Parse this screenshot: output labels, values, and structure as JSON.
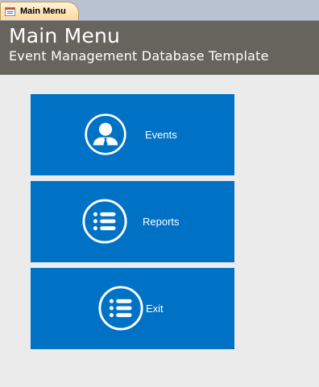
{
  "tab": {
    "label": "Main Menu"
  },
  "header": {
    "title": "Main Menu",
    "subtitle": "Event Management Database Template"
  },
  "buttons": [
    {
      "label": "Events",
      "icon": "person-icon"
    },
    {
      "label": "Reports",
      "icon": "list-icon"
    },
    {
      "label": "Exit",
      "icon": "list-icon"
    }
  ],
  "colors": {
    "header_bg": "#67645d",
    "button_bg": "#0072c6",
    "page_bg": "#ebebeb"
  }
}
